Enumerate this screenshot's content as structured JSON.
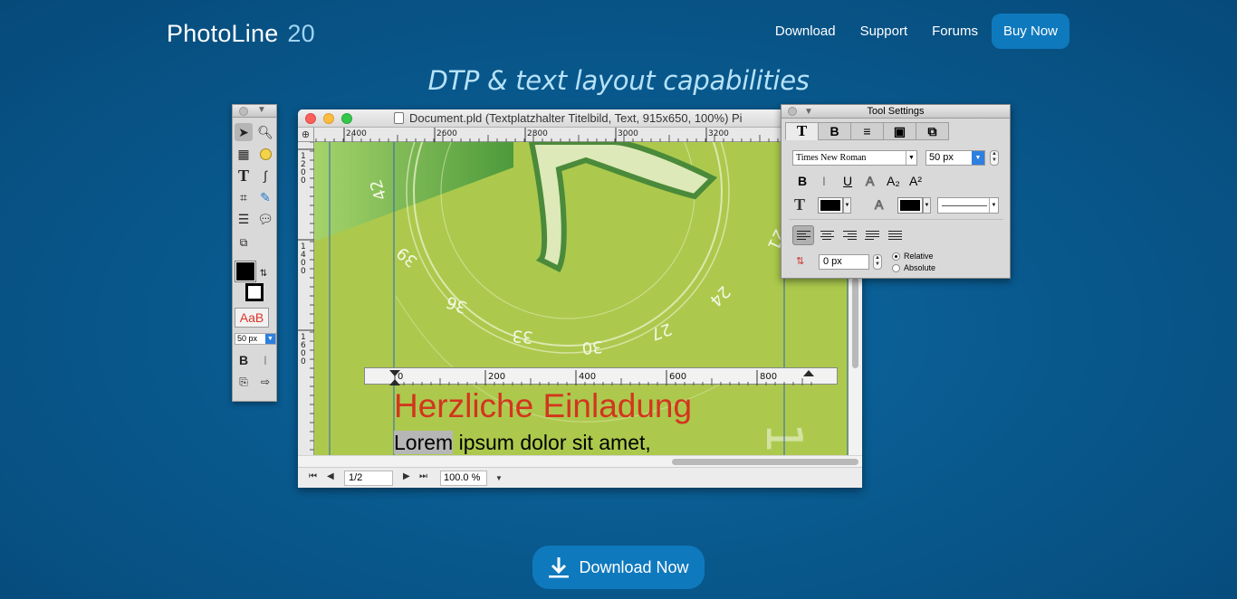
{
  "header": {
    "brand": "PhotoLine",
    "version": "20",
    "nav": {
      "download": "Download",
      "support": "Support",
      "forums": "Forums",
      "buy_now": "Buy Now"
    }
  },
  "tagline": "DTP & text layout capabilities",
  "tools_palette": {
    "font_size": "50 px",
    "text_style_sample": "AaB",
    "bold": "B",
    "italic": "I"
  },
  "document": {
    "title": "Document.pld (Textplatzhalter Titelbild, Text, 915x650, 100%) Pi",
    "hruler_labels": [
      "2400",
      "2600",
      "2800",
      "3000",
      "3200"
    ],
    "vruler_labels": [
      "1200",
      "1400",
      "1600"
    ],
    "text_ruler_labels": [
      "0",
      "200",
      "400",
      "600",
      "800"
    ],
    "dial_numbers": [
      "42",
      "39",
      "36",
      "33",
      "30",
      "27",
      "24",
      "21",
      "15"
    ],
    "headline": "Herzliche Einladung",
    "body_selected": "Lorem",
    "body_rest": " ipsum dolor sit amet,",
    "page": "1/2",
    "zoom": "100.0 %"
  },
  "tool_settings": {
    "title": "Tool Settings",
    "tabs": [
      "T",
      "B",
      "≡",
      "▣",
      "⧉"
    ],
    "font": "Times New Roman",
    "size": "50 px",
    "bold": "B",
    "italic": "I",
    "underline": "U",
    "outline": "A",
    "subscript": "A₂",
    "superscript": "A²",
    "spacing": "0 px",
    "relative": "Relative",
    "absolute": "Absolute"
  },
  "download_now": "Download Now",
  "colors": {
    "background": "#095a8f",
    "accent_button": "#0f79bd",
    "tagline": "#b6e2f8",
    "headline_red": "#d3351e",
    "canvas_green": "#acc94d"
  }
}
